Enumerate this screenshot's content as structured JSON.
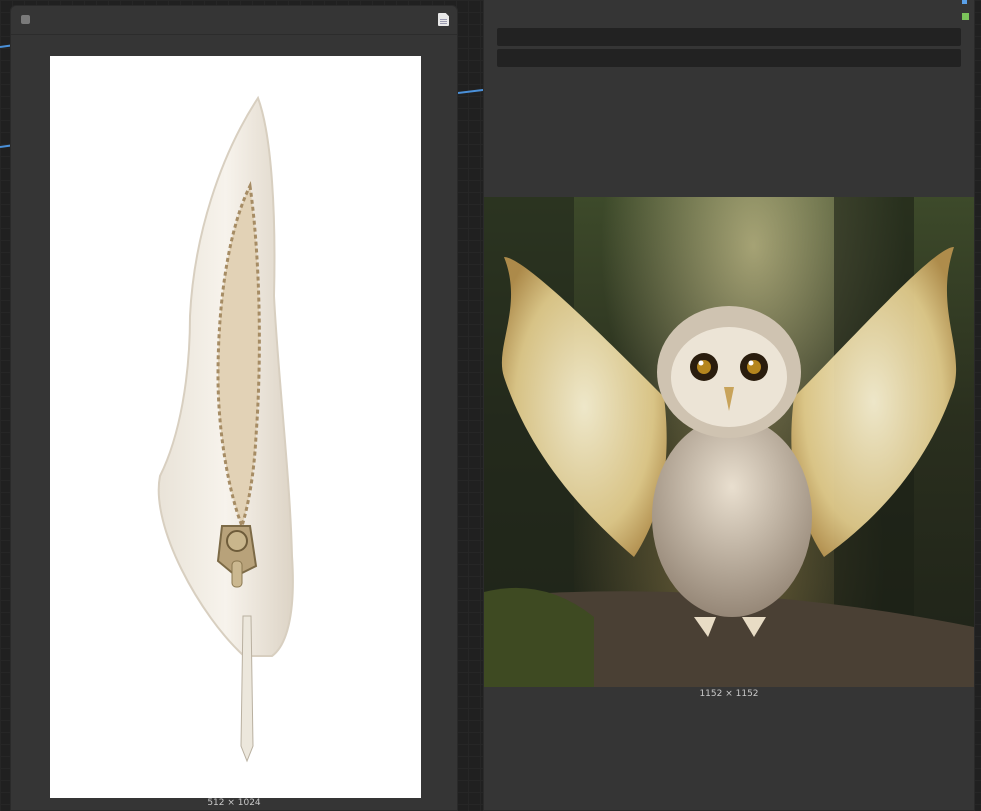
{
  "left_node": {
    "image_size_label": "512 × 1024",
    "image_subject": "feather-sword"
  },
  "right_node": {
    "image_size_label": "1152 × 1152",
    "image_subject": "owl-with-glowing-wings"
  },
  "colors": {
    "canvas_bg": "#202020",
    "node_bg": "#353535",
    "field_bg": "#222222",
    "link_blue": "#4a90d9",
    "slot_green": "#7ac25a"
  }
}
